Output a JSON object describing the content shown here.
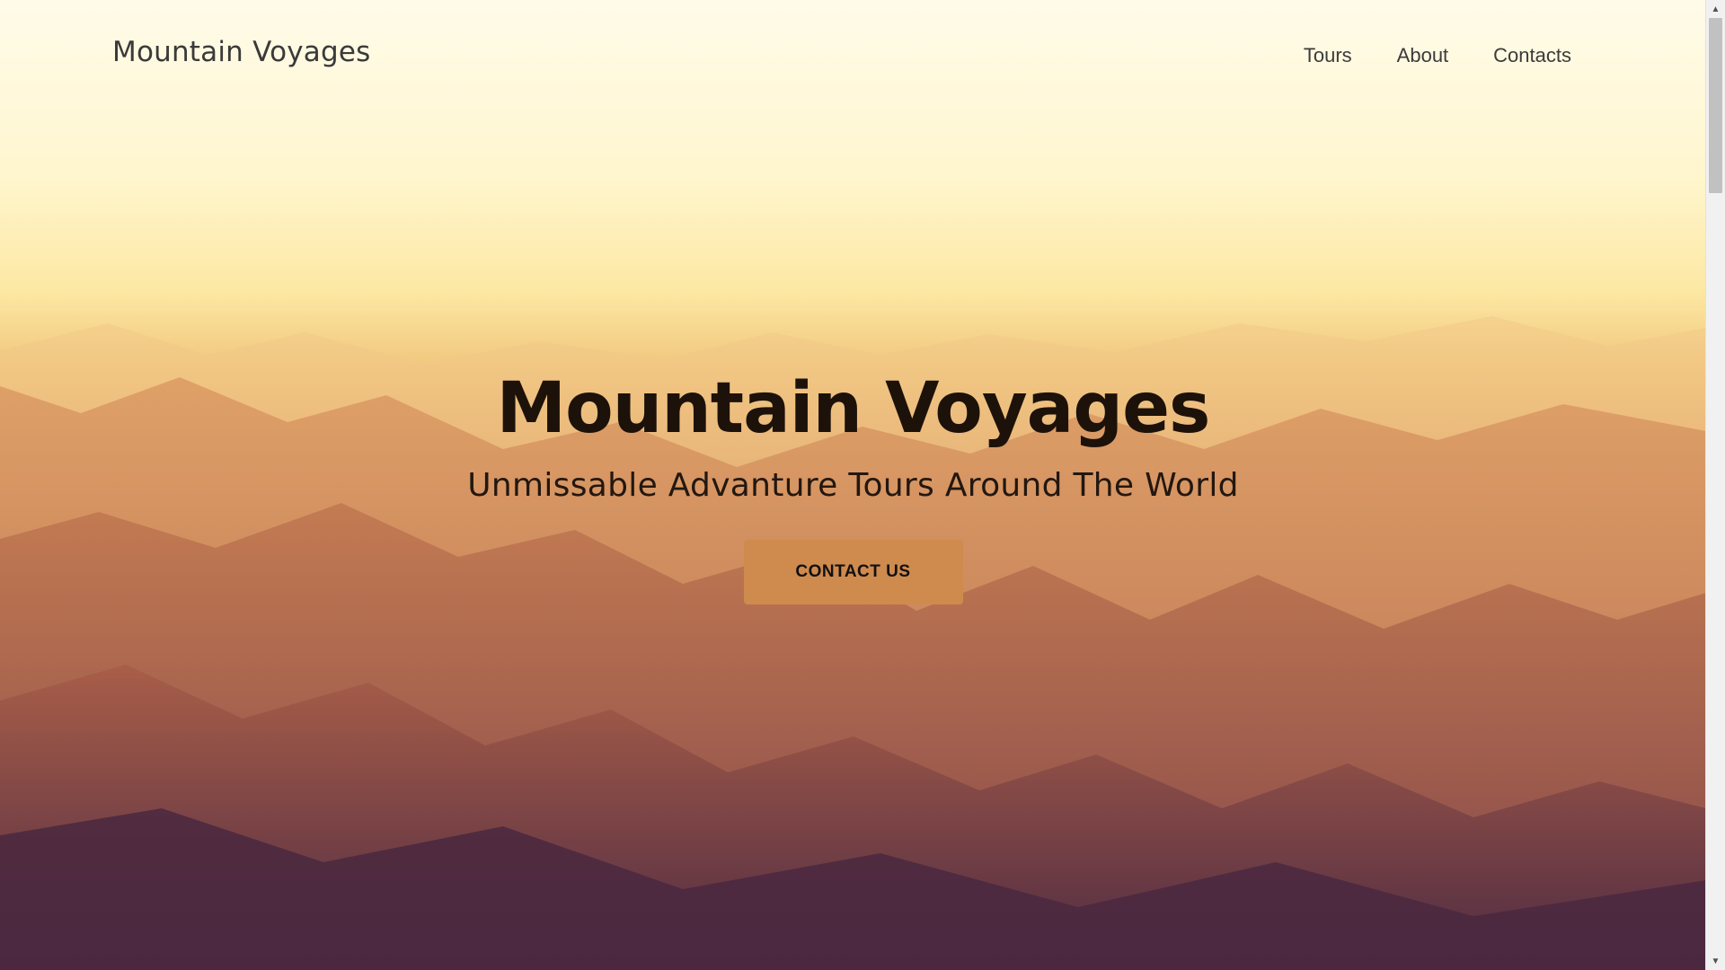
{
  "header": {
    "brand": "Mountain Voyages",
    "nav": [
      {
        "label": "Tours"
      },
      {
        "label": "About"
      },
      {
        "label": "Contacts"
      }
    ]
  },
  "hero": {
    "title": "Mountain Voyages",
    "subtitle": "Unmissable Advanture Tours Around The World",
    "cta_label": "CONTACT US"
  },
  "colors": {
    "cta_background": "#cf8a4e",
    "title_text": "#1d120a"
  },
  "icons": {
    "scroll_up": "chevron-up-icon",
    "scroll_down": "chevron-down-icon"
  }
}
